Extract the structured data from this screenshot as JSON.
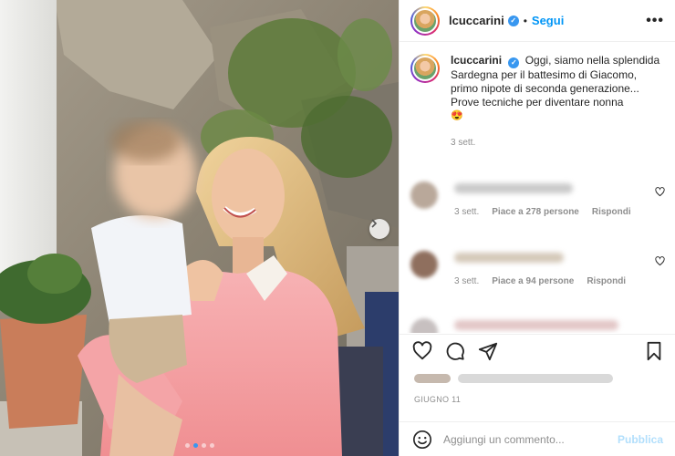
{
  "post": {
    "username": "lcuccarini",
    "follow_label": "Segui",
    "separator": "•",
    "more_label": "•••",
    "verified_mark": "✓"
  },
  "caption": {
    "username": "lcuccarini",
    "text_line1": "Oggi, siamo nella splendida Sardegna per il battesimo di Giacomo, primo nipote di seconda generazione...",
    "text_line2": "Prove tecniche per diventare nonna",
    "emoji": "😍",
    "time": "3 sett."
  },
  "comments": [
    {
      "time": "3 sett.",
      "likes": "Piace a 278 persone",
      "reply": "Rispondi"
    },
    {
      "time": "3 sett.",
      "likes": "Piace a 94 persone",
      "reply": "Rispondi"
    }
  ],
  "footer": {
    "date": "GIUGNO 11",
    "comment_placeholder": "Aggiungi un commento...",
    "publish_label": "Pubblica"
  },
  "icons": {
    "carousel": "chevron-right-icon",
    "like": "heart-icon",
    "comment": "comment-icon",
    "share": "paper-plane-icon",
    "save": "bookmark-icon",
    "emoji": "smiley-icon"
  },
  "carousel": {
    "current": 2,
    "total": 4
  },
  "colors": {
    "accent": "#0095f6",
    "verified": "#3897f0",
    "publish_disabled": "#b2dffc",
    "text_muted": "#8e8e8e"
  }
}
